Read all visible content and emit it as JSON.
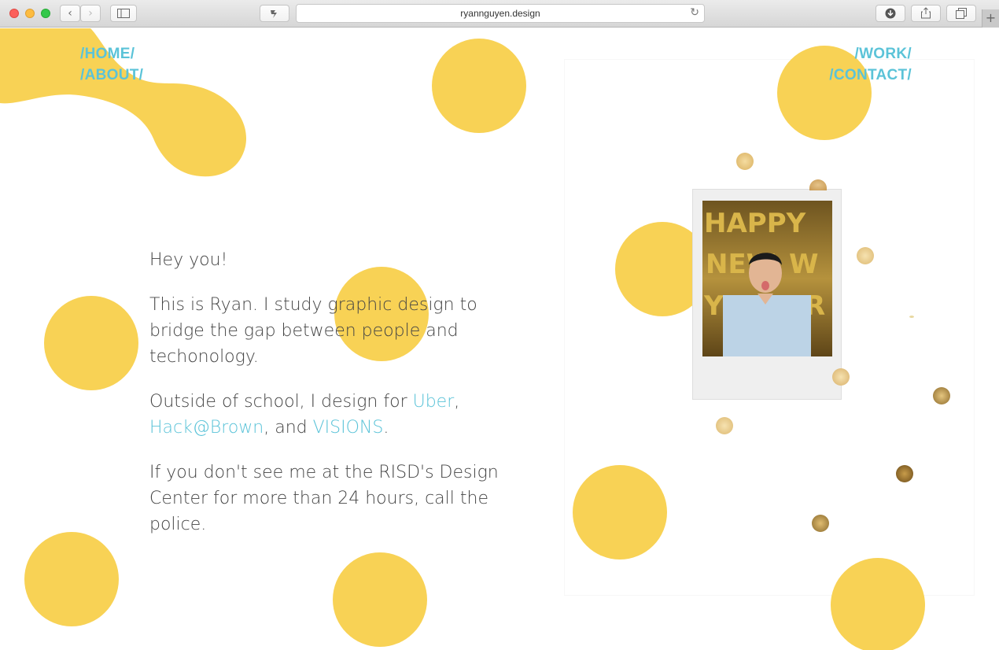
{
  "browser": {
    "url": "ryannguyen.design"
  },
  "nav": {
    "home": "/HOME/",
    "about": "/ABOUT/",
    "work": "/WORK/",
    "contact": "/CONTACT/"
  },
  "intro": {
    "greeting": "Hey you!",
    "p1": "This is Ryan. I study graphic design to bridge the gap between people and techonology.",
    "p2_before": "Outside of school, I design for ",
    "p2_link1": "Uber",
    "p2_sep1": ", ",
    "p2_link2": "Hack@Brown",
    "p2_sep2": ", and ",
    "p2_link3": "VISIONS",
    "p2_end": ".",
    "p3": "If you don't see me at the RISD's Design Center for more than 24 hours, call the police."
  },
  "photo": {
    "balloon_letters": "HAPPY NEW YEAR"
  },
  "colors": {
    "accent_yellow": "#f8d255",
    "link_blue": "#5bc3d8",
    "text": "#444444"
  },
  "icons": [
    "back-icon",
    "forward-icon",
    "sidebar-icon",
    "extension-icon",
    "reload-icon",
    "download-icon",
    "share-icon",
    "tabs-icon",
    "new-tab-icon"
  ]
}
